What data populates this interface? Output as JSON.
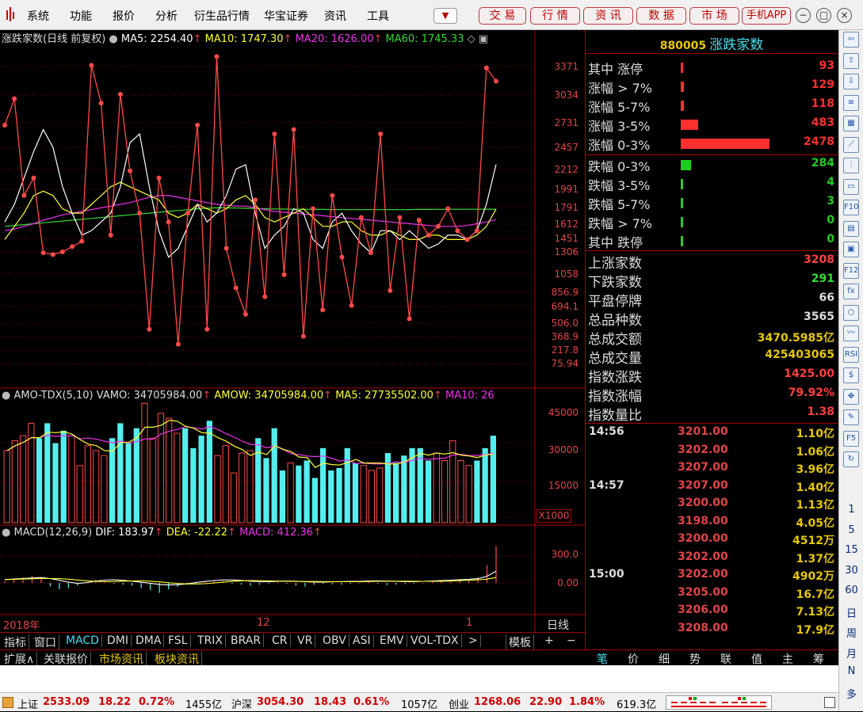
{
  "menubar": {
    "items": [
      "系统",
      "功能",
      "报价",
      "分析",
      "衍生品行情",
      "华宝证券",
      "资讯",
      "工具"
    ],
    "nav_buttons": [
      "交 易",
      "行 情",
      "资 讯",
      "数 据",
      "市 场",
      "手机APP"
    ],
    "window_buttons": [
      "−",
      "□",
      "×"
    ],
    "dropdown_icon": "chevron-down-icon"
  },
  "main_chart": {
    "title": "涨跌家数(日线 前复权)",
    "ma5": "MA5: 2254.40",
    "ma10": "MA10: 1747.30",
    "ma20": "MA20: 1626.00",
    "ma60": "MA60: 1745.33",
    "y_labels": [
      "3371",
      "3034",
      "2731",
      "2457",
      "2212",
      "1991",
      "1791",
      "1612",
      "1451",
      "1306",
      "1058",
      "856.9",
      "694.1",
      "506.0",
      "368.9",
      "217.8",
      "75.94"
    ],
    "colors": {
      "main": "#ff4a4a",
      "ma5": "#ffffff",
      "ma10": "#ffff33",
      "ma20": "#ee33ee",
      "ma60": "#33dd33"
    }
  },
  "vol_chart": {
    "title": "AMO-TDX(5,10)",
    "vamo": "VAMO: 34705984.00",
    "amow": "AMOW: 34705984.00",
    "ma5": "MA5: 27735502.00",
    "ma10": "MA10: 26",
    "y_labels": [
      "45000",
      "30000",
      "15000"
    ],
    "unit": "X1000"
  },
  "macd_chart": {
    "title": "MACD(12,26,9)",
    "dif": "DIF: 183.97",
    "dea": "DEA: -22.22",
    "macd": "MACD: 412.36",
    "y_labels": [
      "300.0",
      "0.00"
    ]
  },
  "x_axis": {
    "labels": [
      "2018年",
      "12",
      "1"
    ],
    "period": "日线"
  },
  "indicator_tabs": [
    "指标",
    "窗口",
    "MACD",
    "DMI",
    "DMA",
    "FSL",
    "TRIX",
    "BRAR",
    "CR",
    "VR",
    "OBV",
    "ASI",
    "EMV",
    "VOL-TDX",
    ">"
  ],
  "template_label": "模板",
  "plus_minus": [
    "+",
    "−"
  ],
  "sub_tabs": [
    "扩展∧",
    "关联报价",
    "市场资讯",
    "板块资讯"
  ],
  "right_panel": {
    "code": "880005",
    "name": "涨跌家数",
    "up_rows": [
      {
        "label": "其中 涨停",
        "value": "93",
        "bar": 0.02
      },
      {
        "label": "涨幅 > 7%",
        "value": "129",
        "bar": 0.04
      },
      {
        "label": "涨幅 5-7%",
        "value": "118",
        "bar": 0.04
      },
      {
        "label": "涨幅 3-5%",
        "value": "483",
        "bar": 0.2
      },
      {
        "label": "涨幅 0-3%",
        "value": "2478",
        "bar": 1.0
      }
    ],
    "down_rows": [
      {
        "label": "跌幅 0-3%",
        "value": "284",
        "bar": 0.12
      },
      {
        "label": "跌幅 3-5%",
        "value": "4",
        "bar": 0.01
      },
      {
        "label": "跌幅 5-7%",
        "value": "3",
        "bar": 0.01
      },
      {
        "label": "跌幅 > 7%",
        "value": "0",
        "bar": 0.01
      },
      {
        "label": "其中 跌停",
        "value": "0",
        "bar": 0.01
      }
    ],
    "stats": [
      {
        "label": "上涨家数",
        "value": "3208",
        "color": "#ff4040"
      },
      {
        "label": "下跌家数",
        "value": "291",
        "color": "#33dd33"
      },
      {
        "label": "平盘停牌",
        "value": "66",
        "color": "#dddddd"
      },
      {
        "label": "总品种数",
        "value": "3565",
        "color": "#dddddd"
      },
      {
        "label": "总成交额",
        "value": "3470.5985亿",
        "color": "#e5c800"
      },
      {
        "label": "总成交量",
        "value": "425403065",
        "color": "#e5c800"
      },
      {
        "label": "指数涨跌",
        "value": "1425.00",
        "color": "#ff4040"
      },
      {
        "label": "指数涨幅",
        "value": "79.92%",
        "color": "#ff4040"
      },
      {
        "label": "指数量比",
        "value": "1.38",
        "color": "#ff4040"
      }
    ],
    "ticks": [
      {
        "time": "14:56",
        "price": "3201.00",
        "vol": "1.10亿"
      },
      {
        "time": "",
        "price": "3202.00",
        "vol": "1.06亿"
      },
      {
        "time": "",
        "price": "3207.00",
        "vol": "3.96亿"
      },
      {
        "time": "14:57",
        "price": "3207.00",
        "vol": "1.40亿"
      },
      {
        "time": "",
        "price": "3200.00",
        "vol": "1.13亿"
      },
      {
        "time": "",
        "price": "3198.00",
        "vol": "4.05亿"
      },
      {
        "time": "",
        "price": "3200.00",
        "vol": "4512万"
      },
      {
        "time": "",
        "price": "3202.00",
        "vol": "1.37亿"
      },
      {
        "time": "15:00",
        "price": "3202.00",
        "vol": "4902万"
      },
      {
        "time": "",
        "price": "3205.00",
        "vol": "16.7亿"
      },
      {
        "time": "",
        "price": "3206.00",
        "vol": "7.13亿"
      },
      {
        "time": "",
        "price": "3208.00",
        "vol": "17.9亿"
      }
    ],
    "tabs": [
      "笔",
      "价",
      "细",
      "势",
      "联",
      "值",
      "主",
      "筹"
    ]
  },
  "sidebar": {
    "icons": [
      "arrow-left-icon",
      "arrow-up-icon",
      "arrow-down-icon",
      "list-icon",
      "grid-icon",
      "line-chart-icon",
      "candle-chart-icon",
      "window-icon",
      "f10-icon",
      "doc-icon",
      "calendar-icon",
      "f12-icon",
      "fx-icon",
      "circle-icon",
      "wave-icon",
      "rsi-icon",
      "dollar-icon",
      "move-icon",
      "pen-icon",
      "f5-icon",
      "refresh-icon"
    ],
    "icon_labels": [
      "⇦",
      "⇧",
      "⇩",
      "≡",
      "▦",
      "⟋",
      "⫶",
      "▭",
      "F10",
      "▤",
      "▣",
      "F12",
      "fx",
      "○",
      "〰",
      "RSI",
      "$",
      "✥",
      "✎",
      "F5",
      "↻"
    ],
    "periods": [
      "1",
      "5",
      "15",
      "30",
      "60",
      "日",
      "周",
      "月",
      "N",
      "多"
    ]
  },
  "statusbar": {
    "sh_name": "上证",
    "sh_val": "2533.09",
    "sh_chg": "18.22",
    "sh_pct": "0.72%",
    "sh_amt": "1455亿",
    "hs_name": "沪深",
    "hs_val": "3054.30",
    "hs_chg": "18.43",
    "hs_pct": "0.61%",
    "hs_amt": "1057亿",
    "cy_name": "创业",
    "cy_val": "1268.06",
    "cy_chg": "22.90",
    "cy_pct": "1.84%",
    "cy_amt": "619.3亿"
  },
  "chart_data": {
    "type": "line",
    "title": "涨跌家数(日线 前复权)",
    "series": [
      {
        "name": "涨跌家数",
        "values": [
          2700,
          3000,
          1900,
          2100,
          1250,
          1230,
          1260,
          1320,
          1380,
          3380,
          2950,
          1450,
          3050,
          2180,
          1700,
          380,
          2100,
          1600,
          210,
          1700,
          2700,
          380,
          3480,
          1300,
          850,
          550,
          1850,
          750,
          2600,
          1000,
          2650,
          300,
          1750,
          600,
          1900,
          1200,
          650,
          1650,
          1250,
          2600,
          820,
          1650,
          500,
          1620,
          1450,
          1550,
          1750,
          1500,
          1400,
          1500,
          3350,
          3200
        ]
      },
      {
        "name": "MA5",
        "values": [
          1600,
          1800,
          2100,
          2400,
          2650,
          2450,
          2000,
          1700,
          1450,
          1500,
          1600,
          1700,
          2000,
          2500,
          2600,
          2000,
          1500,
          1200,
          1300,
          1550,
          1800,
          1600,
          1700,
          1900,
          2200,
          2250,
          1700,
          1300,
          1450,
          1550,
          1750,
          1700,
          1400,
          1300,
          1600,
          1700,
          1500,
          1350,
          1250,
          1500,
          1500,
          1400,
          1500,
          1400,
          1300,
          1350,
          1450,
          1450,
          1400,
          1500,
          1800,
          2254
        ]
      },
      {
        "name": "MA10",
        "values": [
          1400,
          1550,
          1700,
          1900,
          1950,
          1900,
          1750,
          1700,
          1700,
          1800,
          1900,
          2000,
          2050,
          2000,
          1950,
          1900,
          1850,
          1700,
          1650,
          1700,
          1800,
          1750,
          1700,
          1750,
          1850,
          1900,
          1800,
          1650,
          1600,
          1650,
          1700,
          1750,
          1650,
          1550,
          1550,
          1600,
          1600,
          1500,
          1450,
          1450,
          1500,
          1450,
          1400,
          1400,
          1450,
          1450,
          1400,
          1400,
          1400,
          1450,
          1550,
          1747
        ]
      },
      {
        "name": "MA20",
        "values": [
          1500,
          1520,
          1550,
          1580,
          1620,
          1650,
          1680,
          1700,
          1720,
          1740,
          1760,
          1780,
          1800,
          1820,
          1850,
          1880,
          1900,
          1900,
          1880,
          1860,
          1840,
          1820,
          1800,
          1790,
          1780,
          1780,
          1760,
          1740,
          1720,
          1710,
          1700,
          1690,
          1680,
          1670,
          1660,
          1650,
          1640,
          1630,
          1620,
          1610,
          1600,
          1590,
          1580,
          1570,
          1560,
          1550,
          1550,
          1550,
          1560,
          1580,
          1600,
          1626
        ]
      },
      {
        "name": "MA60",
        "values": [
          1550,
          1560,
          1570,
          1580,
          1590,
          1600,
          1610,
          1620,
          1630,
          1640,
          1650,
          1660,
          1670,
          1680,
          1690,
          1700,
          1710,
          1720,
          1730,
          1740,
          1750,
          1755,
          1760,
          1760,
          1758,
          1755,
          1752,
          1750,
          1748,
          1746,
          1745,
          1744,
          1743,
          1742,
          1741,
          1740,
          1740,
          1740,
          1740,
          1740,
          1740,
          1740,
          1741,
          1742,
          1742,
          1743,
          1743,
          1744,
          1744,
          1744,
          1745,
          1745
        ]
      }
    ],
    "ylim": [
      0,
      3600
    ],
    "volume": [
      29,
      33,
      35,
      40,
      34,
      40,
      32,
      37,
      35,
      23,
      31,
      29,
      27,
      34,
      40,
      32,
      38,
      48,
      34,
      44,
      42,
      36,
      38,
      30,
      35,
      41,
      27,
      31,
      20,
      28,
      29,
      34,
      26,
      38,
      21,
      24,
      23,
      25,
      18,
      30,
      21,
      22,
      30,
      24,
      23,
      21,
      22,
      28,
      24,
      27,
      30,
      30,
      25,
      28,
      25,
      33,
      25,
      23,
      25,
      30,
      35
    ],
    "macd": [
      20,
      40,
      60,
      80,
      55,
      -40,
      -70,
      -60,
      -30,
      10,
      40,
      20,
      -10,
      -20,
      -30,
      -60,
      -80,
      -110,
      -70,
      -40,
      -20,
      -10,
      10,
      30,
      20,
      -10,
      -20,
      -30,
      -20,
      -10,
      10,
      -10,
      -30,
      -40,
      -20,
      -10,
      -15,
      -20,
      -10,
      -5,
      10,
      -10,
      -25,
      -20,
      -15,
      -10,
      -5,
      10,
      15,
      20,
      30,
      40,
      60,
      200,
      412
    ]
  }
}
